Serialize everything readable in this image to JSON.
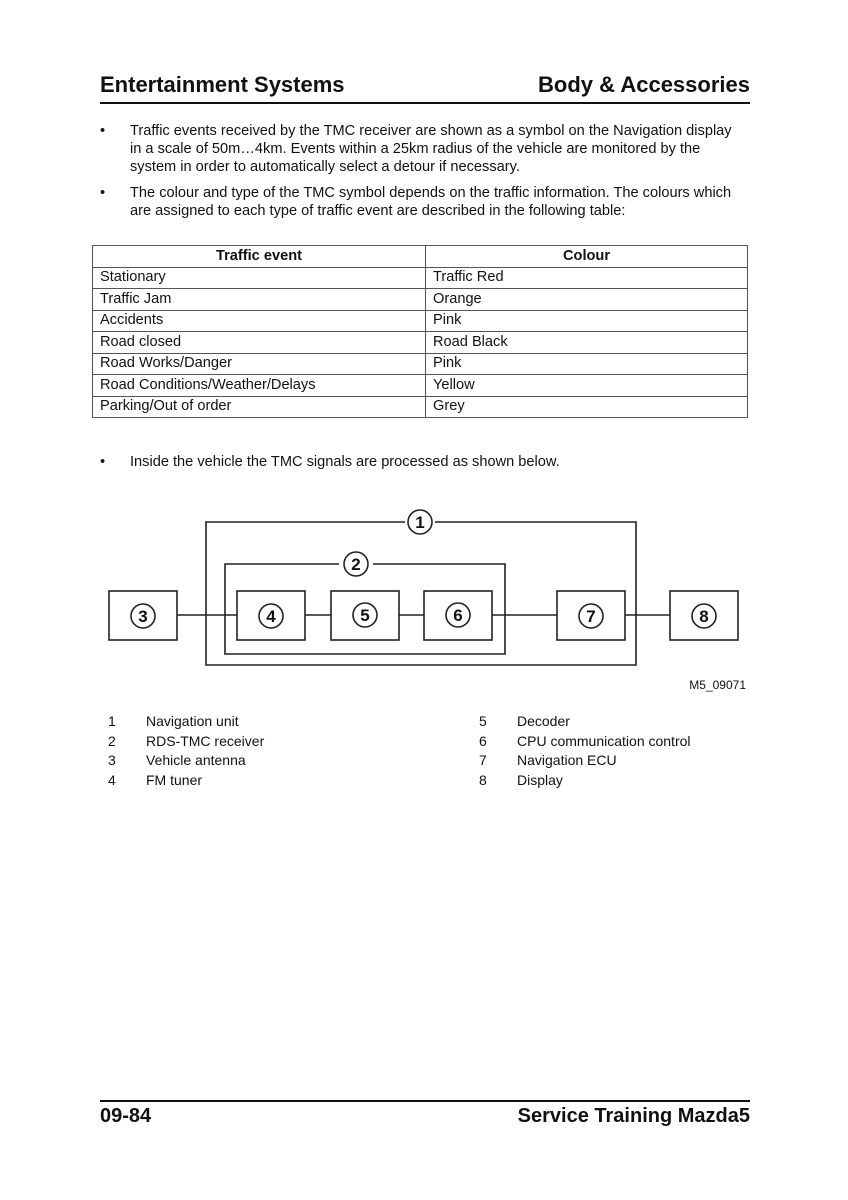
{
  "header": {
    "left_title": "Entertainment Systems",
    "right_title": "Body & Accessories"
  },
  "bullets": [
    {
      "symbol": "•",
      "text": "Traffic events received by the TMC receiver are shown as a symbol on the Navigation display in a scale of 50m…4km. Events within a 25km radius of the vehicle are monitored by the system in order to automatically select a detour if necessary."
    },
    {
      "symbol": "•",
      "text": "The colour and type of the TMC symbol depends on the traffic information. The colours which are assigned to each type of traffic event are described in the following table:"
    }
  ],
  "table": {
    "headers": [
      "Traffic event",
      "Colour"
    ],
    "rows": [
      [
        "Stationary",
        "Traffic Red"
      ],
      [
        "Traffic Jam",
        "Orange"
      ],
      [
        "Accidents",
        "Pink"
      ],
      [
        "Road closed",
        "Road Black"
      ],
      [
        "Road Works/Danger",
        "Pink"
      ],
      [
        "Road Conditions/Weather/Delays",
        "Yellow"
      ],
      [
        "Parking/Out of order",
        "Grey"
      ]
    ]
  },
  "bullet3": {
    "symbol": "•",
    "text": "Inside the vehicle the TMC signals are processed as shown below."
  },
  "diagram": {
    "labels": {
      "n1": "1",
      "n2": "2",
      "n3": "3",
      "n4": "4",
      "n5": "5",
      "n6": "6",
      "n7": "7",
      "n8": "8"
    },
    "figure_id": "M5_09071"
  },
  "legend": {
    "left": [
      {
        "num": "1",
        "label": "Navigation unit"
      },
      {
        "num": "2",
        "label": "RDS-TMC receiver"
      },
      {
        "num": "3",
        "label": "Vehicle antenna"
      },
      {
        "num": "4",
        "label": "FM tuner"
      }
    ],
    "right": [
      {
        "num": "5",
        "label": "Decoder"
      },
      {
        "num": "6",
        "label": "CPU communication control"
      },
      {
        "num": "7",
        "label": "Navigation ECU"
      },
      {
        "num": "8",
        "label": "Display"
      }
    ]
  },
  "footer": {
    "page_number": "09-84",
    "title": "Service Training Mazda5"
  }
}
